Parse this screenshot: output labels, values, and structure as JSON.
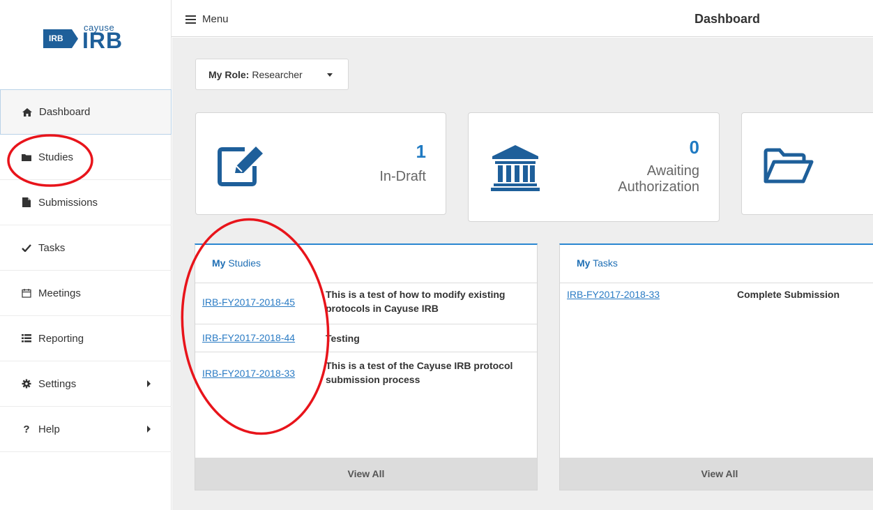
{
  "brand": {
    "chip": "IRB",
    "small": "cayuse",
    "big": "IRB"
  },
  "topbar": {
    "menu_label": "Menu",
    "page_title": "Dashboard"
  },
  "sidebar": {
    "items": [
      {
        "label": "Dashboard",
        "icon": "home-icon"
      },
      {
        "label": "Studies",
        "icon": "folder-icon"
      },
      {
        "label": "Submissions",
        "icon": "file-icon"
      },
      {
        "label": "Tasks",
        "icon": "check-icon"
      },
      {
        "label": "Meetings",
        "icon": "calendar-icon"
      },
      {
        "label": "Reporting",
        "icon": "list-icon"
      },
      {
        "label": "Settings",
        "icon": "gear-icon"
      },
      {
        "label": "Help",
        "icon": "help-icon"
      }
    ]
  },
  "role": {
    "prefix": "My Role:",
    "value": "Researcher"
  },
  "stats": [
    {
      "value": "1",
      "label": "In-Draft",
      "icon": "edit-icon"
    },
    {
      "value": "0",
      "label_line1": "Awaiting",
      "label_line2": "Authorization",
      "icon": "institution-icon"
    },
    {
      "icon": "folder-open-icon"
    }
  ],
  "my_studies": {
    "title_my": "My",
    "title_rest": "Studies",
    "rows": [
      {
        "id": "IRB-FY2017-2018-45",
        "desc": "This is a test of how to modify existing protocols in Cayuse IRB"
      },
      {
        "id": "IRB-FY2017-2018-44",
        "desc": "Testing"
      },
      {
        "id": "IRB-FY2017-2018-33",
        "desc": "This is a test of the Cayuse IRB protocol submission process"
      }
    ],
    "footer": "View All"
  },
  "my_tasks": {
    "title_my": "My",
    "title_rest": "Tasks",
    "rows": [
      {
        "id": "IRB-FY2017-2018-33",
        "desc": "Complete Submission"
      }
    ],
    "footer": "View All"
  },
  "colors": {
    "accent": "#1f7ac2",
    "brand": "#1e5f9a",
    "annotation": "#e8141b"
  }
}
